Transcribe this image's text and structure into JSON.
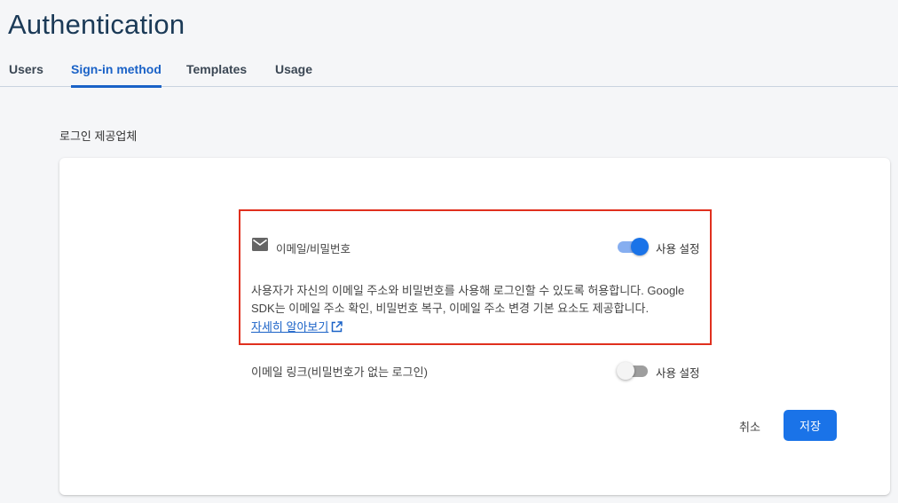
{
  "header": {
    "title": "Authentication"
  },
  "tabs": [
    {
      "label": "Users",
      "active": false
    },
    {
      "label": "Sign-in method",
      "active": true
    },
    {
      "label": "Templates",
      "active": false
    },
    {
      "label": "Usage",
      "active": false
    }
  ],
  "section": {
    "label": "로그인 제공업체"
  },
  "provider": {
    "icon": "mail-icon",
    "label": "이메일/비밀번호",
    "enabled": true,
    "toggle_label": "사용 설정",
    "description": "사용자가 자신의 이메일 주소와 비밀번호를 사용해 로그인할 수 있도록 허용합니다. Google SDK는 이메일 주소 확인, 비밀번호 복구, 이메일 주소 변경 기본 요소도 제공합니다.",
    "learn_more": "자세히 알아보기"
  },
  "email_link": {
    "label": "이메일 링크(비밀번호가 없는 로그인)",
    "enabled": false,
    "toggle_label": "사용 설정"
  },
  "actions": {
    "cancel": "취소",
    "save": "저장"
  },
  "colors": {
    "accent": "#1a73e8",
    "highlight": "#e0301e",
    "title": "#1b3a57"
  }
}
